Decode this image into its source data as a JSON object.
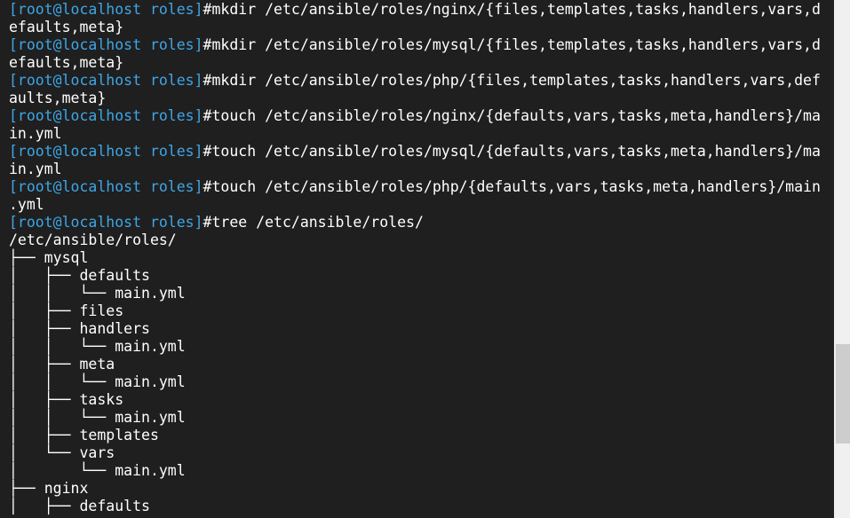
{
  "terminal": {
    "lines": [
      {
        "prompt": "[root@localhost roles]",
        "text": "#mkdir /etc/ansible/roles/nginx/{files,templates,tasks,handlers,vars,d"
      },
      {
        "prompt": "",
        "text": "efaults,meta}"
      },
      {
        "prompt": "[root@localhost roles]",
        "text": "#mkdir /etc/ansible/roles/mysql/{files,templates,tasks,handlers,vars,d"
      },
      {
        "prompt": "",
        "text": "efaults,meta}"
      },
      {
        "prompt": "[root@localhost roles]",
        "text": "#mkdir /etc/ansible/roles/php/{files,templates,tasks,handlers,vars,def"
      },
      {
        "prompt": "",
        "text": "aults,meta}"
      },
      {
        "prompt": "[root@localhost roles]",
        "text": "#touch /etc/ansible/roles/nginx/{defaults,vars,tasks,meta,handlers}/ma"
      },
      {
        "prompt": "",
        "text": "in.yml"
      },
      {
        "prompt": "[root@localhost roles]",
        "text": "#touch /etc/ansible/roles/mysql/{defaults,vars,tasks,meta,handlers}/ma"
      },
      {
        "prompt": "",
        "text": "in.yml"
      },
      {
        "prompt": "[root@localhost roles]",
        "text": "#touch /etc/ansible/roles/php/{defaults,vars,tasks,meta,handlers}/main"
      },
      {
        "prompt": "",
        "text": ".yml"
      },
      {
        "prompt": "[root@localhost roles]",
        "text": "#tree /etc/ansible/roles/"
      },
      {
        "prompt": "",
        "text": "/etc/ansible/roles/"
      },
      {
        "prompt": "",
        "text": "├── mysql"
      },
      {
        "prompt": "",
        "text": "│   ├── defaults"
      },
      {
        "prompt": "",
        "text": "│   │   └── main.yml"
      },
      {
        "prompt": "",
        "text": "│   ├── files"
      },
      {
        "prompt": "",
        "text": "│   ├── handlers"
      },
      {
        "prompt": "",
        "text": "│   │   └── main.yml"
      },
      {
        "prompt": "",
        "text": "│   ├── meta"
      },
      {
        "prompt": "",
        "text": "│   │   └── main.yml"
      },
      {
        "prompt": "",
        "text": "│   ├── tasks"
      },
      {
        "prompt": "",
        "text": "│   │   └── main.yml"
      },
      {
        "prompt": "",
        "text": "│   ├── templates"
      },
      {
        "prompt": "",
        "text": "│   └── vars"
      },
      {
        "prompt": "",
        "text": "│       └── main.yml"
      },
      {
        "prompt": "",
        "text": "├── nginx"
      },
      {
        "prompt": "",
        "text": "│   ├── defaults"
      }
    ]
  },
  "colors": {
    "background": "#1f1f1f",
    "text": "#ffffff",
    "prompt": "#3ea6e6",
    "scrollbar_track": "#f0f0f0",
    "scrollbar_thumb": "#cdcdcd"
  }
}
